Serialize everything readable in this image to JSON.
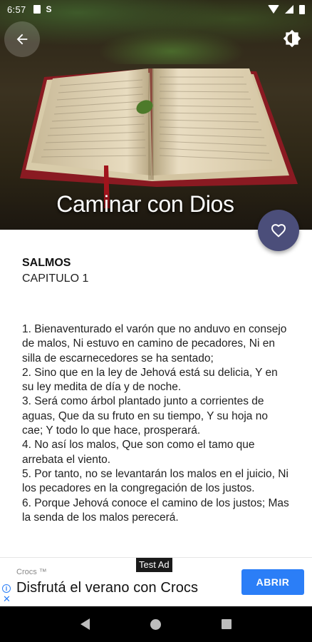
{
  "status_bar": {
    "time": "6:57",
    "left_icons": [
      "sim-card-icon",
      "s-icon"
    ],
    "right_icons": [
      "wifi-icon",
      "signal-icon",
      "battery-icon"
    ]
  },
  "header": {
    "title": "Caminar con Dios",
    "back_icon": "arrow-left-icon",
    "theme_icon": "brightness-icon",
    "image": "open-bible-photo"
  },
  "fab": {
    "icon": "heart-outline-icon",
    "color": "#4b4e7a"
  },
  "content": {
    "book": "SALMOS",
    "chapter": "CAPITULO 1",
    "verses": [
      "1. Bienaventurado el varón que no anduvo en consejo de malos, Ni estuvo en camino de pecadores, Ni en silla de escarnecedores se ha sentado;",
      "2. Sino que en la ley de Jehová está su delicia, Y en su ley medita de día y de noche.",
      "3. Será como árbol plantado junto a corrientes de aguas, Que da su fruto en su tiempo, Y su hoja no cae; Y todo lo que hace, prosperará.",
      "4. No así los malos, Que son como el tamo que arrebata el viento.",
      "5. Por tanto, no se levantarán los malos en el juicio, Ni los pecadores en la congregación de los justos.",
      "6. Porque Jehová conoce el camino de los justos; Mas la senda de los malos perecerá."
    ]
  },
  "ad": {
    "label": "Test Ad",
    "brand": "Crocs ™",
    "headline": "Disfrutá el verano con Crocs",
    "cta": "ABRIR",
    "info_glyph": "i",
    "close_glyph": "✕",
    "cta_color": "#2b7ef7"
  },
  "nav_bar": {
    "icons": [
      "nav-back-icon",
      "nav-home-icon",
      "nav-recents-icon"
    ]
  }
}
